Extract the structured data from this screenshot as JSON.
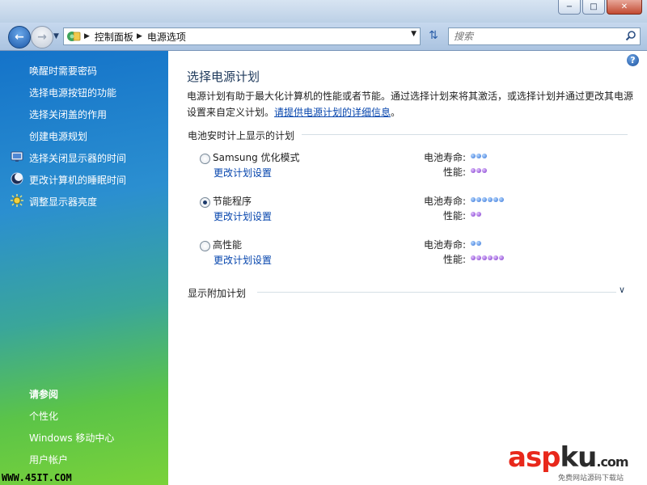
{
  "window": {
    "min_glyph": "−",
    "max_glyph": "□",
    "close_glyph": "✕"
  },
  "nav": {
    "breadcrumb": [
      "控制面板",
      "电源选项"
    ],
    "search_placeholder": "搜索"
  },
  "sidebar": {
    "tasks": [
      {
        "label": "唤醒时需要密码",
        "icon": ""
      },
      {
        "label": "选择电源按钮的功能",
        "icon": ""
      },
      {
        "label": "选择关闭盖的作用",
        "icon": ""
      },
      {
        "label": "创建电源规划",
        "icon": ""
      },
      {
        "label": "选择关闭显示器的时间",
        "icon": "monitor-icon"
      },
      {
        "label": "更改计算机的睡眠时间",
        "icon": "moon-icon"
      },
      {
        "label": "调整显示器亮度",
        "icon": "sun-icon"
      }
    ],
    "see_also_title": "请参阅",
    "see_also": [
      "个性化",
      "Windows 移动中心",
      "用户帐户"
    ]
  },
  "main": {
    "help_glyph": "?",
    "title": "选择电源计划",
    "description": "电源计划有助于最大化计算机的性能或者节能。通过选择计划来将其激活，或选择计划并通过更改其电源设置来自定义计划。",
    "description_link": "请提供电源计划的详细信息",
    "description_end": "。",
    "group_label": "电池安时计上显示的计划",
    "battery_label": "电池寿命:",
    "performance_label": "性能:",
    "plans": [
      {
        "name": "Samsung 优化模式",
        "link": "更改计划设置",
        "selected": false,
        "battery": 3,
        "performance": 3
      },
      {
        "name": "节能程序",
        "link": "更改计划设置",
        "selected": true,
        "battery": 6,
        "performance": 2
      },
      {
        "name": "高性能",
        "link": "更改计划设置",
        "selected": false,
        "battery": 2,
        "performance": 6
      }
    ],
    "more_plans_label": "显示附加计划"
  },
  "watermarks": {
    "left": "WWW.45IT.COM",
    "right_a": "asp",
    "right_b": "ku",
    "right_c": ".com",
    "right_sub": "免费网站源码下载站"
  },
  "colors": {
    "link": "#0645ad",
    "battery_dot": "#2f6fd6",
    "performance_dot": "#7a33c9"
  }
}
